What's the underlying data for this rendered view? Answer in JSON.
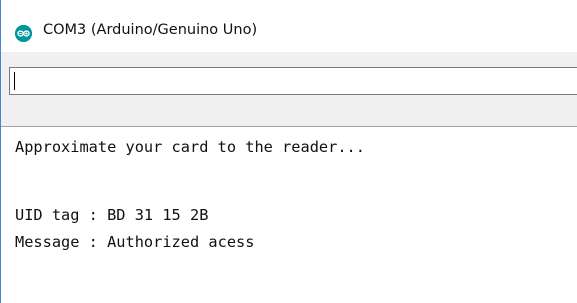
{
  "window": {
    "title": "COM3 (Arduino/Genuino Uno)",
    "icon": "arduino-logo-icon",
    "accent_color": "#00979c"
  },
  "input": {
    "value": "",
    "placeholder": ""
  },
  "output": {
    "lines": [
      "Approximate your card to the reader...",
      "",
      "UID tag : BD 31 15 2B",
      "Message : Authorized acess"
    ]
  }
}
